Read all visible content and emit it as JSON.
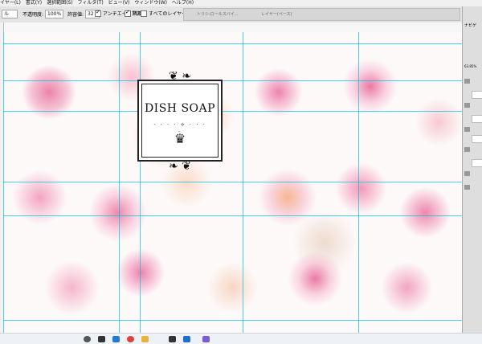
{
  "menubar": [
    "イヤー(L)",
    "書式(Y)",
    "選択範囲(S)",
    "フィルタ(T)",
    "ビュー(V)",
    "ウィンドウ(W)",
    "ヘルプ(H)"
  ],
  "options": {
    "mode_value": "ル",
    "opacity_label": "不透明度:",
    "opacity_value": "100%",
    "tolerance_label": "許容値:",
    "tolerance_value": "32",
    "antialias_label": "アンチエイリアス",
    "contiguous_label": "隣接",
    "all_layers_label": "すべてのレイヤー"
  },
  "doc_tabs": [
    "トリシ-ロールスバイ...",
    "レイヤー(ペース)"
  ],
  "label": {
    "title": "DISH SOAP",
    "divider": "· · · · ⟡ · · · ·"
  },
  "panel": {
    "top_label": "ナビゲ",
    "zoom_readout": "63.85%"
  },
  "icons": {
    "crown": "crown-icon",
    "ornament": "flourish-ornament"
  },
  "colors": {
    "canvas_bg": "#fdf9f9",
    "guide": "#00bedc",
    "taskbar": "#eef1f5"
  }
}
